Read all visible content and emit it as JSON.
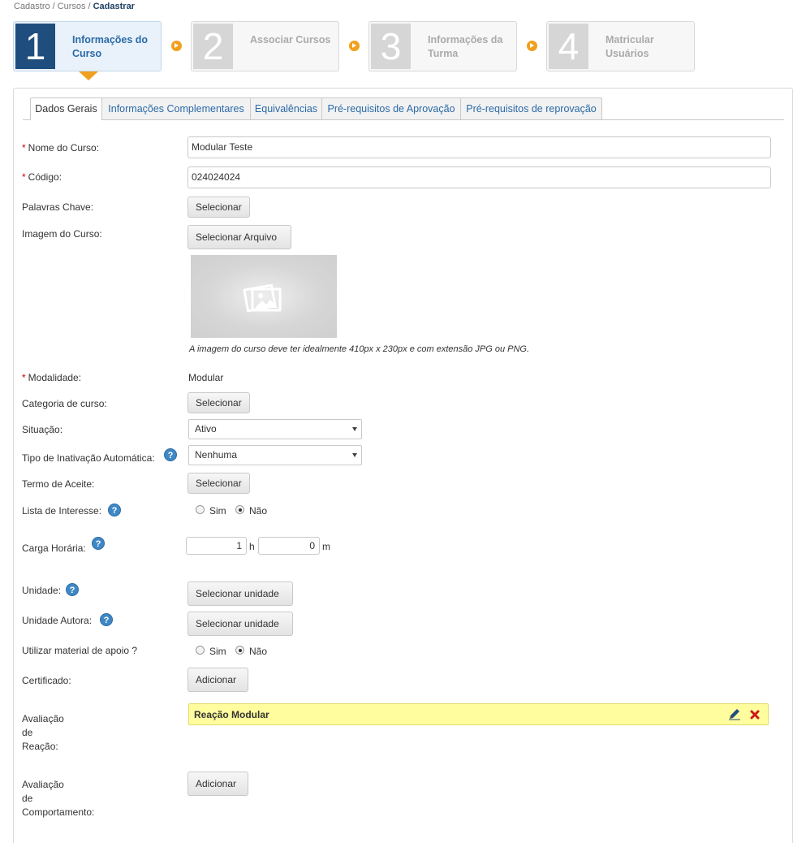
{
  "breadcrumb": {
    "part1": "Cadastro",
    "part2": "Cursos",
    "current": "Cadastrar",
    "separator": "/"
  },
  "steps": [
    {
      "number": "1",
      "label": "Informações do Curso"
    },
    {
      "number": "2",
      "label": "Associar Cursos"
    },
    {
      "number": "3",
      "label": "Informações da Turma"
    },
    {
      "number": "4",
      "label": "Matricular Usuários"
    }
  ],
  "tabs": [
    "Dados Gerais",
    "Informações Complementares",
    "Equivalências",
    "Pré-requisitos de Aprovação",
    "Pré-requisitos de reprovação"
  ],
  "form": {
    "required_mark": "*",
    "help_glyph": "?",
    "nome": {
      "label": "Nome do Curso:",
      "value": "Modular Teste"
    },
    "codigo": {
      "label": "Código:",
      "value": "024024024"
    },
    "palavras": {
      "label": "Palavras Chave:",
      "button": "Selecionar"
    },
    "imagem": {
      "label": "Imagem do Curso:",
      "button": "Selecionar Arquivo",
      "caption": "A imagem do curso deve ter idealmente 410px x 230px e com extensão JPG ou PNG."
    },
    "modalidade": {
      "label": "Modalidade:",
      "value": "Modular"
    },
    "categoria": {
      "label": "Categoria de curso:",
      "button": "Selecionar"
    },
    "situacao": {
      "label": "Situação:",
      "value": "Ativo"
    },
    "tipo_inativacao": {
      "label": "Tipo de Inativação Automática:",
      "value": "Nenhuma"
    },
    "termo": {
      "label": "Termo de Aceite:",
      "button": "Selecionar"
    },
    "lista_interesse": {
      "label": "Lista de Interesse:",
      "option_yes": "Sim",
      "option_no": "Não",
      "selected": "Não"
    },
    "carga": {
      "label": "Carga Horária:",
      "hours": "1",
      "hours_unit": "h",
      "minutes": "0",
      "minutes_unit": "m"
    },
    "unidade": {
      "label": "Unidade:",
      "button": "Selecionar unidade"
    },
    "unidade_autora": {
      "label": "Unidade Autora:",
      "button": "Selecionar unidade"
    },
    "material_apoio": {
      "label": "Utilizar material de apoio ?",
      "option_yes": "Sim",
      "option_no": "Não",
      "selected": "Não"
    },
    "certificado": {
      "label": "Certificado:",
      "button": "Adicionar"
    },
    "avaliacao_reacao": {
      "label_lines": [
        "Avaliação",
        "de",
        "Reação:"
      ],
      "item": "Reação Modular"
    },
    "avaliacao_comportamento": {
      "label_lines": [
        "Avaliação",
        "de",
        "Comportamento:"
      ],
      "button": "Adicionar"
    }
  },
  "icons": {
    "image_placeholder": "image-icon",
    "edit": "pencil-icon",
    "remove": "close-icon",
    "help": "help-icon"
  },
  "colors": {
    "primary": "#1f4d7e",
    "link": "#2a6aa7",
    "accent": "#f0a01e",
    "required": "#cc0000",
    "highlight": "#fffd9e",
    "delete": "#d01818"
  }
}
